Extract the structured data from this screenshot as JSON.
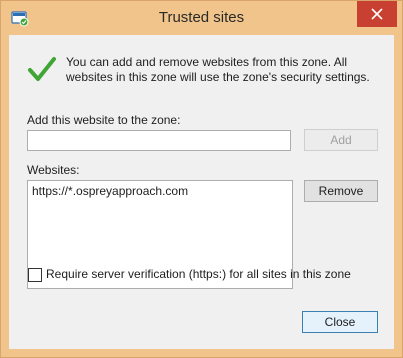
{
  "window": {
    "title": "Trusted sites",
    "title_icon": "trusted-sites-icon",
    "close_icon": "close-icon"
  },
  "info": {
    "icon": "checkmark-icon",
    "text": "You can add and remove websites from this zone. All websites in this zone will use the zone's security settings."
  },
  "add_section": {
    "label": "Add this website to the zone:",
    "input_value": "",
    "add_button": "Add"
  },
  "websites_section": {
    "label": "Websites:",
    "items": [
      "https://*.ospreyapproach.com"
    ],
    "remove_button": "Remove"
  },
  "require_verification": {
    "label": "Require server verification (https:) for all sites in this zone",
    "checked": false
  },
  "footer": {
    "close_button": "Close"
  },
  "colors": {
    "title_bar": "#f0c48a",
    "close_button_bg": "#c84031",
    "client_bg": "#f0f0f0",
    "check_green": "#3fa535"
  }
}
